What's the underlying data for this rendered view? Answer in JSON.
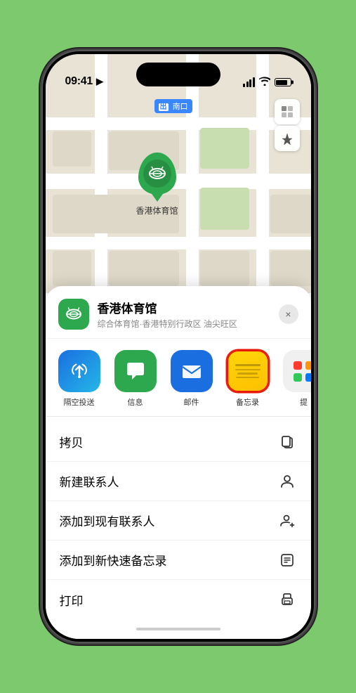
{
  "status": {
    "time": "09:41",
    "location_arrow": "▲"
  },
  "map": {
    "label": "南口",
    "marker_name": "香港体育馆",
    "marker_sublabel": "香港体育馆"
  },
  "location_card": {
    "name": "香港体育馆",
    "subtitle": "综合体育馆·香港特别行政区 油尖旺区",
    "close_label": "×"
  },
  "share_apps": [
    {
      "id": "airdrop",
      "label": "隔空投送",
      "type": "airdrop"
    },
    {
      "id": "messages",
      "label": "信息",
      "type": "messages"
    },
    {
      "id": "mail",
      "label": "邮件",
      "type": "mail"
    },
    {
      "id": "notes",
      "label": "备忘录",
      "type": "notes"
    },
    {
      "id": "more",
      "label": "提",
      "type": "more"
    }
  ],
  "actions": [
    {
      "id": "copy",
      "label": "拷贝",
      "icon": "copy"
    },
    {
      "id": "new-contact",
      "label": "新建联系人",
      "icon": "person-add"
    },
    {
      "id": "add-existing",
      "label": "添加到现有联系人",
      "icon": "person-plus"
    },
    {
      "id": "add-notes",
      "label": "添加到新快速备忘录",
      "icon": "notes-add"
    },
    {
      "id": "print",
      "label": "打印",
      "icon": "printer"
    }
  ]
}
